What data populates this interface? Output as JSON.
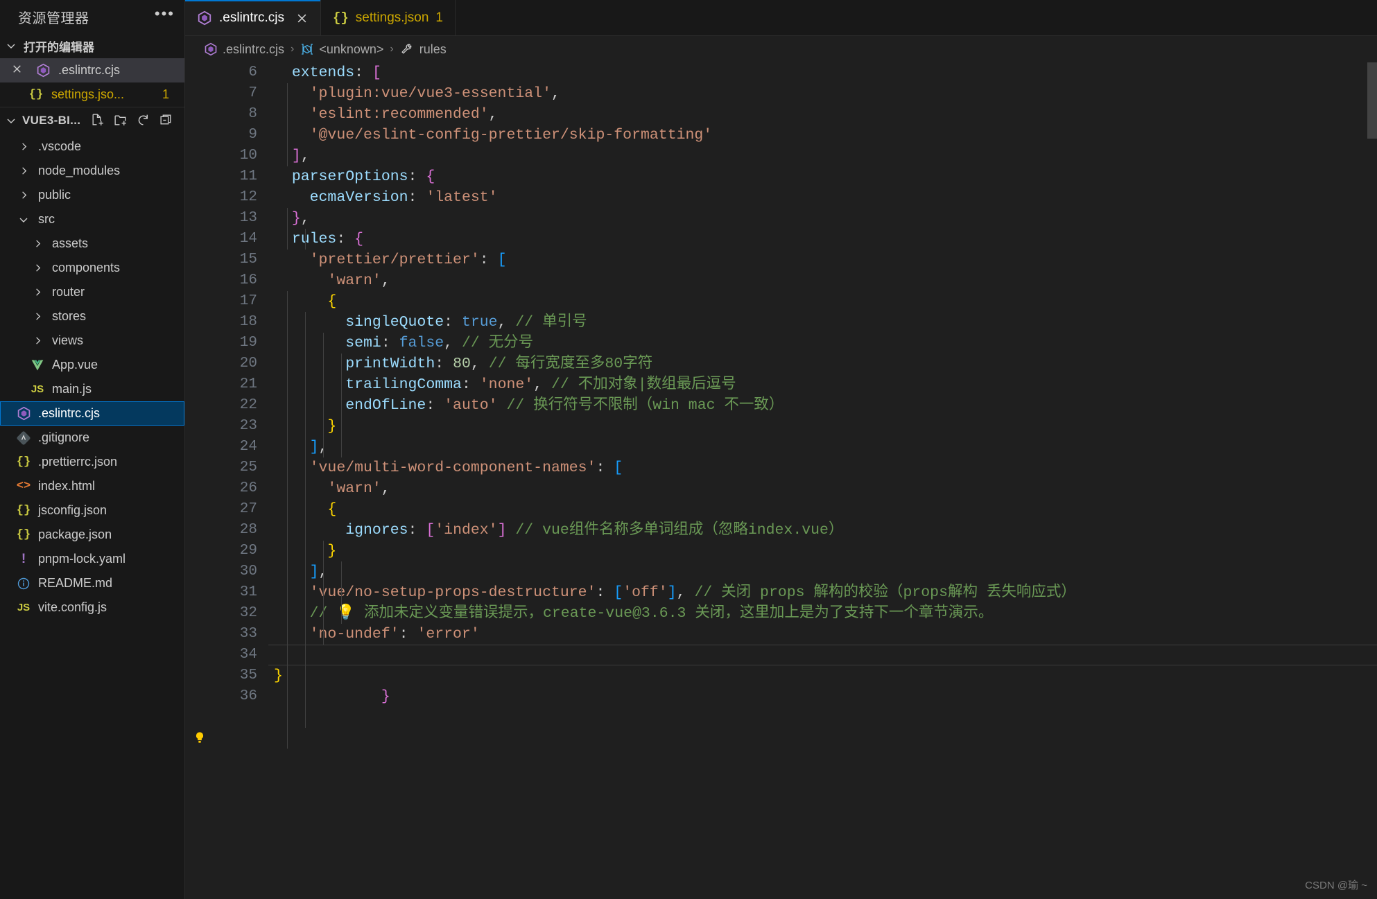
{
  "sidebar": {
    "title": "资源管理器",
    "more_icon": "ellipsis-icon",
    "open_editors": {
      "label": "打开的编辑器",
      "items": [
        {
          "name": ".eslintrc.cjs",
          "icon": "eslint-icon",
          "close_icon": "close-icon",
          "active": true,
          "badge": ""
        },
        {
          "name": "settings.jso...",
          "icon": "json-icon",
          "active": false,
          "badge": "1"
        }
      ]
    },
    "folder": {
      "label": "VUE3-BI...",
      "actions": [
        "new-file-icon",
        "new-folder-icon",
        "refresh-icon",
        "collapse-all-icon"
      ]
    },
    "tree": [
      {
        "label": ".vscode",
        "type": "folder",
        "expanded": false,
        "indent": 1
      },
      {
        "label": "node_modules",
        "type": "folder",
        "expanded": false,
        "indent": 1
      },
      {
        "label": "public",
        "type": "folder",
        "expanded": false,
        "indent": 1
      },
      {
        "label": "src",
        "type": "folder",
        "expanded": true,
        "indent": 1
      },
      {
        "label": "assets",
        "type": "folder",
        "expanded": false,
        "indent": 2
      },
      {
        "label": "components",
        "type": "folder",
        "expanded": false,
        "indent": 2
      },
      {
        "label": "router",
        "type": "folder",
        "expanded": false,
        "indent": 2
      },
      {
        "label": "stores",
        "type": "folder",
        "expanded": false,
        "indent": 2
      },
      {
        "label": "views",
        "type": "folder",
        "expanded": false,
        "indent": 2
      },
      {
        "label": "App.vue",
        "type": "file",
        "icon": "vue-icon",
        "indent": 2
      },
      {
        "label": "main.js",
        "type": "file",
        "icon": "js-icon",
        "indent": 2
      },
      {
        "label": ".eslintrc.cjs",
        "type": "file",
        "icon": "eslint-icon",
        "indent": 1,
        "selected": true
      },
      {
        "label": ".gitignore",
        "type": "file",
        "icon": "git-icon",
        "indent": 1
      },
      {
        "label": ".prettierrc.json",
        "type": "file",
        "icon": "json-icon",
        "indent": 1
      },
      {
        "label": "index.html",
        "type": "file",
        "icon": "html-icon",
        "indent": 1
      },
      {
        "label": "jsconfig.json",
        "type": "file",
        "icon": "json-icon",
        "indent": 1
      },
      {
        "label": "package.json",
        "type": "file",
        "icon": "json-icon",
        "indent": 1
      },
      {
        "label": "pnpm-lock.yaml",
        "type": "file",
        "icon": "yaml-icon",
        "indent": 1
      },
      {
        "label": "README.md",
        "type": "file",
        "icon": "info-icon",
        "indent": 1
      },
      {
        "label": "vite.config.js",
        "type": "file",
        "icon": "js-icon",
        "indent": 1
      }
    ]
  },
  "tabs": [
    {
      "label": ".eslintrc.cjs",
      "icon": "eslint-icon",
      "active": true,
      "close_icon": "close-icon",
      "badge": ""
    },
    {
      "label": "settings.json",
      "icon": "json-icon",
      "active": false,
      "badge": "1"
    }
  ],
  "breadcrumb": {
    "items": [
      {
        "label": ".eslintrc.cjs",
        "icon": "eslint-icon"
      },
      {
        "label": "<unknown>",
        "icon": "module-icon"
      },
      {
        "label": "rules",
        "icon": "wrench-icon"
      }
    ],
    "separator": "›"
  },
  "editor": {
    "first_line": 6,
    "cursor_line": 34,
    "lightbulb_line": 33,
    "lines": [
      {
        "n": 6,
        "tokens": [
          {
            "t": "  ",
            "c": "t-punc"
          },
          {
            "t": "extends",
            "c": "t-prop"
          },
          {
            "t": ": ",
            "c": "t-punc"
          },
          {
            "t": "[",
            "c": "t-brk-p"
          }
        ]
      },
      {
        "n": 7,
        "tokens": [
          {
            "t": "    ",
            "c": "t-punc"
          },
          {
            "t": "'plugin:vue/vue3-essential'",
            "c": "t-str"
          },
          {
            "t": ",",
            "c": "t-punc"
          }
        ]
      },
      {
        "n": 8,
        "tokens": [
          {
            "t": "    ",
            "c": "t-punc"
          },
          {
            "t": "'eslint:recommended'",
            "c": "t-str"
          },
          {
            "t": ",",
            "c": "t-punc"
          }
        ]
      },
      {
        "n": 9,
        "tokens": [
          {
            "t": "    ",
            "c": "t-punc"
          },
          {
            "t": "'@vue/eslint-config-prettier/skip-formatting'",
            "c": "t-str"
          }
        ]
      },
      {
        "n": 10,
        "tokens": [
          {
            "t": "  ",
            "c": "t-punc"
          },
          {
            "t": "]",
            "c": "t-brk-p"
          },
          {
            "t": ",",
            "c": "t-punc"
          }
        ]
      },
      {
        "n": 11,
        "tokens": [
          {
            "t": "  ",
            "c": "t-punc"
          },
          {
            "t": "parserOptions",
            "c": "t-prop"
          },
          {
            "t": ": ",
            "c": "t-punc"
          },
          {
            "t": "{",
            "c": "t-brk-p"
          }
        ]
      },
      {
        "n": 12,
        "tokens": [
          {
            "t": "    ",
            "c": "t-punc"
          },
          {
            "t": "ecmaVersion",
            "c": "t-prop"
          },
          {
            "t": ": ",
            "c": "t-punc"
          },
          {
            "t": "'latest'",
            "c": "t-str"
          }
        ]
      },
      {
        "n": 13,
        "tokens": [
          {
            "t": "  ",
            "c": "t-punc"
          },
          {
            "t": "}",
            "c": "t-brk-p"
          },
          {
            "t": ",",
            "c": "t-punc"
          }
        ]
      },
      {
        "n": 14,
        "tokens": [
          {
            "t": "  ",
            "c": "t-punc"
          },
          {
            "t": "rules",
            "c": "t-prop"
          },
          {
            "t": ": ",
            "c": "t-punc"
          },
          {
            "t": "{",
            "c": "t-brk-p"
          }
        ]
      },
      {
        "n": 15,
        "tokens": [
          {
            "t": "    ",
            "c": "t-punc"
          },
          {
            "t": "'prettier/prettier'",
            "c": "t-str"
          },
          {
            "t": ": ",
            "c": "t-punc"
          },
          {
            "t": "[",
            "c": "t-brk-b"
          }
        ]
      },
      {
        "n": 16,
        "tokens": [
          {
            "t": "      ",
            "c": "t-punc"
          },
          {
            "t": "'warn'",
            "c": "t-str"
          },
          {
            "t": ",",
            "c": "t-punc"
          }
        ]
      },
      {
        "n": 17,
        "tokens": [
          {
            "t": "      ",
            "c": "t-punc"
          },
          {
            "t": "{",
            "c": "t-brk-y"
          }
        ]
      },
      {
        "n": 18,
        "tokens": [
          {
            "t": "        ",
            "c": "t-punc"
          },
          {
            "t": "singleQuote",
            "c": "t-prop"
          },
          {
            "t": ": ",
            "c": "t-punc"
          },
          {
            "t": "true",
            "c": "t-kw"
          },
          {
            "t": ", ",
            "c": "t-punc"
          },
          {
            "t": "// 单引号",
            "c": "t-cmt"
          }
        ]
      },
      {
        "n": 19,
        "tokens": [
          {
            "t": "        ",
            "c": "t-punc"
          },
          {
            "t": "semi",
            "c": "t-prop"
          },
          {
            "t": ": ",
            "c": "t-punc"
          },
          {
            "t": "false",
            "c": "t-kw"
          },
          {
            "t": ", ",
            "c": "t-punc"
          },
          {
            "t": "// 无分号",
            "c": "t-cmt"
          }
        ]
      },
      {
        "n": 20,
        "tokens": [
          {
            "t": "        ",
            "c": "t-punc"
          },
          {
            "t": "printWidth",
            "c": "t-prop"
          },
          {
            "t": ": ",
            "c": "t-punc"
          },
          {
            "t": "80",
            "c": "t-num"
          },
          {
            "t": ", ",
            "c": "t-punc"
          },
          {
            "t": "// 每行宽度至多80字符",
            "c": "t-cmt"
          }
        ]
      },
      {
        "n": 21,
        "tokens": [
          {
            "t": "        ",
            "c": "t-punc"
          },
          {
            "t": "trailingComma",
            "c": "t-prop"
          },
          {
            "t": ": ",
            "c": "t-punc"
          },
          {
            "t": "'none'",
            "c": "t-str"
          },
          {
            "t": ", ",
            "c": "t-punc"
          },
          {
            "t": "// 不加对象|数组最后逗号",
            "c": "t-cmt"
          }
        ]
      },
      {
        "n": 22,
        "tokens": [
          {
            "t": "        ",
            "c": "t-punc"
          },
          {
            "t": "endOfLine",
            "c": "t-prop"
          },
          {
            "t": ": ",
            "c": "t-punc"
          },
          {
            "t": "'auto'",
            "c": "t-str"
          },
          {
            "t": " ",
            "c": "t-punc"
          },
          {
            "t": "// 换行符号不限制（win mac 不一致）",
            "c": "t-cmt"
          }
        ]
      },
      {
        "n": 23,
        "tokens": [
          {
            "t": "      ",
            "c": "t-punc"
          },
          {
            "t": "}",
            "c": "t-brk-y"
          }
        ]
      },
      {
        "n": 24,
        "tokens": [
          {
            "t": "    ",
            "c": "t-punc"
          },
          {
            "t": "]",
            "c": "t-brk-b"
          },
          {
            "t": ",",
            "c": "t-punc"
          }
        ]
      },
      {
        "n": 25,
        "tokens": [
          {
            "t": "    ",
            "c": "t-punc"
          },
          {
            "t": "'vue/multi-word-component-names'",
            "c": "t-str"
          },
          {
            "t": ": ",
            "c": "t-punc"
          },
          {
            "t": "[",
            "c": "t-brk-b"
          }
        ]
      },
      {
        "n": 26,
        "tokens": [
          {
            "t": "      ",
            "c": "t-punc"
          },
          {
            "t": "'warn'",
            "c": "t-str"
          },
          {
            "t": ",",
            "c": "t-punc"
          }
        ]
      },
      {
        "n": 27,
        "tokens": [
          {
            "t": "      ",
            "c": "t-punc"
          },
          {
            "t": "{",
            "c": "t-brk-y"
          }
        ]
      },
      {
        "n": 28,
        "tokens": [
          {
            "t": "        ",
            "c": "t-punc"
          },
          {
            "t": "ignores",
            "c": "t-prop"
          },
          {
            "t": ": ",
            "c": "t-punc"
          },
          {
            "t": "[",
            "c": "t-brk-p"
          },
          {
            "t": "'index'",
            "c": "t-str"
          },
          {
            "t": "]",
            "c": "t-brk-p"
          },
          {
            "t": " ",
            "c": "t-punc"
          },
          {
            "t": "// vue组件名称多单词组成（忽略index.vue）",
            "c": "t-cmt"
          }
        ]
      },
      {
        "n": 29,
        "tokens": [
          {
            "t": "      ",
            "c": "t-punc"
          },
          {
            "t": "}",
            "c": "t-brk-y"
          }
        ]
      },
      {
        "n": 30,
        "tokens": [
          {
            "t": "    ",
            "c": "t-punc"
          },
          {
            "t": "]",
            "c": "t-brk-b"
          },
          {
            "t": ",",
            "c": "t-punc"
          }
        ]
      },
      {
        "n": 31,
        "tokens": [
          {
            "t": "    ",
            "c": "t-punc"
          },
          {
            "t": "'vue/no-setup-props-destructure'",
            "c": "t-str"
          },
          {
            "t": ": ",
            "c": "t-punc"
          },
          {
            "t": "[",
            "c": "t-brk-b"
          },
          {
            "t": "'off'",
            "c": "t-str"
          },
          {
            "t": "]",
            "c": "t-brk-b"
          },
          {
            "t": ", ",
            "c": "t-punc"
          },
          {
            "t": "// 关闭 props 解构的校验（props解构 丢失响应式）",
            "c": "t-cmt"
          }
        ]
      },
      {
        "n": 32,
        "tokens": [
          {
            "t": "    ",
            "c": "t-punc"
          },
          {
            "t": "// 💡 添加未定义变量错误提示，create-vue@3.6.3 关闭，这里加上是为了支持下一个章节演示。",
            "c": "t-cmt"
          }
        ]
      },
      {
        "n": 33,
        "tokens": [
          {
            "t": "    ",
            "c": "t-punc"
          },
          {
            "t": "'no-undef'",
            "c": "t-str"
          },
          {
            "t": ": ",
            "c": "t-punc"
          },
          {
            "t": "'error'",
            "c": "t-str"
          }
        ]
      },
      {
        "n": 34,
        "tokens": [
          {
            "t": "  ",
            "c": "t-punc"
          },
          {
            "t": "}",
            "c": "t-brk-p"
          }
        ]
      },
      {
        "n": 35,
        "tokens": [
          {
            "t": "}",
            "c": "t-brk-y"
          }
        ]
      },
      {
        "n": 36,
        "tokens": []
      }
    ]
  },
  "watermark": "CSDN @瑜 ~",
  "colors": {
    "accent": "#0078d4",
    "selection": "#04395e",
    "warning": "#cca700",
    "editor_bg": "#1f1f1f",
    "sidebar_bg": "#181818"
  }
}
